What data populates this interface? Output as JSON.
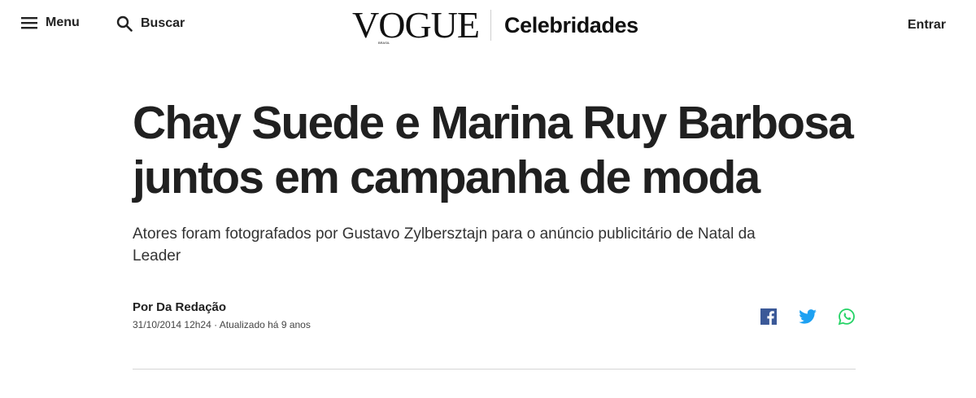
{
  "header": {
    "menu_label": "Menu",
    "search_label": "Buscar",
    "logo_text": "VOGUE",
    "logo_sub": "BRASIL",
    "section_label": "Celebridades",
    "login_label": "Entrar"
  },
  "article": {
    "headline": "Chay Suede e Marina Ruy Barbosa juntos em campanha de moda",
    "subtitle": "Atores foram fotografados por Gustavo Zylbersztajn para o anúncio publicitário de Natal da Leader",
    "author": "Por Da Redação",
    "meta": "31/10/2014 12h24 · Atualizado há 9 anos"
  },
  "share": {
    "icons": [
      "facebook-icon",
      "twitter-icon",
      "whatsapp-icon"
    ],
    "colors": {
      "facebook": "#3b5998",
      "twitter": "#1da1f2",
      "whatsapp": "#25d366"
    }
  },
  "colors": {
    "text": "#222222",
    "divider": "#d6d6d6"
  }
}
